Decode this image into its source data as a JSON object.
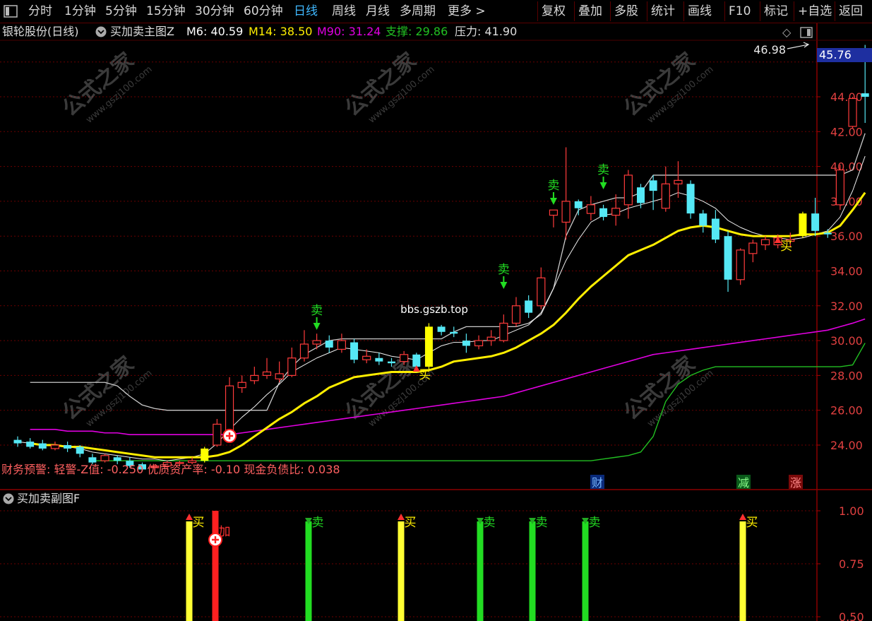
{
  "topbar": {
    "left_items": [
      "分时",
      "1分钟",
      "5分钟",
      "15分钟",
      "30分钟",
      "60分钟",
      "日线",
      "周线",
      "月线",
      "多周期",
      "更多 >"
    ],
    "active_item": "日线",
    "right_items": [
      "复权",
      "叠加",
      "多股",
      "统计",
      "画线",
      "F10",
      "标记",
      "+自选",
      "返回"
    ]
  },
  "main_header": {
    "stock": "银轮股份(日线)",
    "indicator": "买加卖主图Z",
    "m6": "M6: 40.59",
    "m14": "M14: 38.50",
    "m90": "M90: 31.24",
    "support": "支撑: 29.86",
    "pressure": "压力: 41.90"
  },
  "colors": {
    "bg": "#000000",
    "grid": "#6b0000",
    "up": "#ff3b3b",
    "down": "#55e8f5",
    "m6": "#ffffff",
    "m14": "#ffee00",
    "m90": "#e000e0",
    "support": "#22c022",
    "sell": "#22dd22",
    "buy_bar": "#ffff33",
    "add_bar": "#ff2020",
    "price_tag": "#1e2fa0"
  },
  "price_axis": {
    "ticks": [
      "44.00",
      "42.00",
      "40.00",
      "38.00",
      "36.00",
      "34.00",
      "32.00",
      "30.00",
      "28.00",
      "26.00",
      "24.00"
    ],
    "current": "45.76",
    "high_label": "46.98"
  },
  "signals": {
    "main": [
      {
        "text": "卖",
        "kind": "sell"
      },
      {
        "text": "卖",
        "kind": "sell"
      },
      {
        "text": "卖",
        "kind": "sell"
      },
      {
        "text": "卖",
        "kind": "sell"
      },
      {
        "text": "买",
        "kind": "buy"
      },
      {
        "text": "买",
        "kind": "buy"
      }
    ],
    "watermark_text": "bbs.gszb.top"
  },
  "finance_warning": "财务预警: 轻警-Z值: -0.250 优质资产率: -0.10 现金负债比: 0.038",
  "event_markers": [
    "财",
    "减",
    "涨"
  ],
  "sub_chart": {
    "title": "买加卖副图F",
    "ticks": [
      "1.00",
      "0.75",
      "0.50"
    ],
    "bars": [
      {
        "label": "买",
        "kind": "buy"
      },
      {
        "label": "加",
        "kind": "add"
      },
      {
        "label": "卖",
        "kind": "sell"
      },
      {
        "label": "买",
        "kind": "buy"
      },
      {
        "label": "卖",
        "kind": "sell"
      },
      {
        "label": "卖",
        "kind": "sell"
      },
      {
        "label": "卖",
        "kind": "sell"
      },
      {
        "label": "买",
        "kind": "buy"
      }
    ]
  },
  "watermarks": {
    "cn": "公式之家",
    "url": "www.gszj100.com"
  },
  "candles": [
    {
      "o": 24.3,
      "c": 24.1,
      "h": 24.5,
      "l": 23.9
    },
    {
      "o": 24.2,
      "c": 23.9,
      "h": 24.4,
      "l": 23.8
    },
    {
      "o": 24.1,
      "c": 23.8,
      "h": 24.3,
      "l": 23.7
    },
    {
      "o": 23.8,
      "c": 24.0,
      "h": 24.2,
      "l": 23.7
    },
    {
      "o": 24.0,
      "c": 23.8,
      "h": 24.2,
      "l": 23.6
    },
    {
      "o": 23.9,
      "c": 23.5,
      "h": 24.0,
      "l": 23.3
    },
    {
      "o": 23.3,
      "c": 23.0,
      "h": 23.5,
      "l": 22.9
    },
    {
      "o": 23.1,
      "c": 23.4,
      "h": 23.5,
      "l": 23.0
    },
    {
      "o": 23.3,
      "c": 23.1,
      "h": 23.4,
      "l": 22.9
    },
    {
      "o": 23.1,
      "c": 22.8,
      "h": 23.3,
      "l": 22.7
    },
    {
      "o": 22.9,
      "c": 22.6,
      "h": 23.0,
      "l": 22.5
    },
    {
      "o": 22.7,
      "c": 22.8,
      "h": 22.9,
      "l": 22.4
    },
    {
      "o": 22.8,
      "c": 23.0,
      "h": 23.1,
      "l": 22.6
    },
    {
      "o": 23.0,
      "c": 23.0,
      "h": 23.1,
      "l": 22.8
    },
    {
      "o": 23.0,
      "c": 23.1,
      "h": 23.3,
      "l": 22.9
    },
    {
      "o": 23.1,
      "c": 23.8,
      "h": 23.9,
      "l": 23.0
    },
    {
      "o": 24.0,
      "c": 25.2,
      "h": 25.5,
      "l": 23.9
    },
    {
      "o": 24.5,
      "c": 27.4,
      "h": 27.9,
      "l": 24.3
    },
    {
      "o": 27.3,
      "c": 27.6,
      "h": 28.0,
      "l": 27.0
    },
    {
      "o": 27.7,
      "c": 28.0,
      "h": 28.5,
      "l": 27.5
    },
    {
      "o": 28.0,
      "c": 28.2,
      "h": 29.0,
      "l": 27.8
    },
    {
      "o": 27.8,
      "c": 28.1,
      "h": 28.8,
      "l": 27.6
    },
    {
      "o": 28.0,
      "c": 29.0,
      "h": 29.6,
      "l": 27.9
    },
    {
      "o": 29.0,
      "c": 29.8,
      "h": 30.6,
      "l": 28.8
    },
    {
      "o": 29.8,
      "c": 30.0,
      "h": 30.4,
      "l": 29.5
    },
    {
      "o": 30.0,
      "c": 29.6,
      "h": 30.3,
      "l": 29.3
    },
    {
      "o": 29.5,
      "c": 30.0,
      "h": 30.4,
      "l": 29.3
    },
    {
      "o": 29.9,
      "c": 28.9,
      "h": 30.1,
      "l": 28.7
    },
    {
      "o": 28.9,
      "c": 29.1,
      "h": 29.5,
      "l": 28.7
    },
    {
      "o": 29.0,
      "c": 28.8,
      "h": 29.3,
      "l": 28.6
    },
    {
      "o": 28.8,
      "c": 28.7,
      "h": 29.0,
      "l": 28.5
    },
    {
      "o": 28.8,
      "c": 29.2,
      "h": 29.4,
      "l": 28.6
    },
    {
      "o": 29.2,
      "c": 28.5,
      "h": 29.3,
      "l": 28.2
    },
    {
      "o": 28.5,
      "c": 30.8,
      "h": 31.0,
      "l": 28.3
    },
    {
      "o": 30.8,
      "c": 30.5,
      "h": 30.9,
      "l": 30.3
    },
    {
      "o": 30.5,
      "c": 30.4,
      "h": 30.8,
      "l": 30.2
    },
    {
      "o": 30.0,
      "c": 29.7,
      "h": 30.4,
      "l": 29.3
    },
    {
      "o": 29.7,
      "c": 30.0,
      "h": 30.3,
      "l": 29.5
    },
    {
      "o": 30.0,
      "c": 30.2,
      "h": 30.6,
      "l": 29.7
    },
    {
      "o": 30.0,
      "c": 31.0,
      "h": 31.5,
      "l": 29.9
    },
    {
      "o": 31.0,
      "c": 32.0,
      "h": 32.5,
      "l": 30.8
    },
    {
      "o": 32.3,
      "c": 31.6,
      "h": 32.6,
      "l": 31.3
    },
    {
      "o": 32.0,
      "c": 33.6,
      "h": 34.2,
      "l": 31.8
    },
    {
      "o": 37.2,
      "c": 37.5,
      "h": 37.5,
      "l": 36.5
    },
    {
      "o": 36.8,
      "c": 38.0,
      "h": 41.1,
      "l": 35.8
    },
    {
      "o": 38.0,
      "c": 37.6,
      "h": 38.1,
      "l": 37.2
    },
    {
      "o": 37.3,
      "c": 37.8,
      "h": 38.3,
      "l": 36.9
    },
    {
      "o": 37.6,
      "c": 37.1,
      "h": 37.8,
      "l": 36.9
    },
    {
      "o": 37.2,
      "c": 37.6,
      "h": 38.4,
      "l": 36.6
    },
    {
      "o": 37.8,
      "c": 39.5,
      "h": 39.8,
      "l": 37.0
    },
    {
      "o": 38.8,
      "c": 37.9,
      "h": 39.0,
      "l": 37.6
    },
    {
      "o": 39.2,
      "c": 38.6,
      "h": 39.5,
      "l": 37.5
    },
    {
      "o": 37.6,
      "c": 39.0,
      "h": 40.0,
      "l": 37.4
    },
    {
      "o": 39.0,
      "c": 39.2,
      "h": 40.3,
      "l": 38.2
    },
    {
      "o": 39.0,
      "c": 37.3,
      "h": 39.2,
      "l": 37.0
    },
    {
      "o": 37.3,
      "c": 36.6,
      "h": 37.5,
      "l": 36.2
    },
    {
      "o": 37.0,
      "c": 35.8,
      "h": 37.5,
      "l": 35.6
    },
    {
      "o": 36.0,
      "c": 33.5,
      "h": 36.3,
      "l": 32.8
    },
    {
      "o": 33.5,
      "c": 35.2,
      "h": 35.3,
      "l": 33.2
    },
    {
      "o": 35.0,
      "c": 35.6,
      "h": 35.8,
      "l": 34.5
    },
    {
      "o": 35.5,
      "c": 35.8,
      "h": 36.0,
      "l": 35.2
    },
    {
      "o": 35.5,
      "c": 35.9,
      "h": 36.1,
      "l": 35.3
    },
    {
      "o": 35.7,
      "c": 35.8,
      "h": 36.2,
      "l": 35.4
    },
    {
      "o": 36.0,
      "c": 37.3,
      "h": 37.4,
      "l": 35.9
    },
    {
      "o": 37.3,
      "c": 36.3,
      "h": 38.2,
      "l": 36.0
    },
    {
      "o": 36.2,
      "c": 36.1,
      "h": 36.4,
      "l": 35.9
    },
    {
      "o": 37.8,
      "c": 39.8,
      "h": 40.1,
      "l": 37.5
    },
    {
      "o": 42.3,
      "c": 43.9,
      "h": 44.0,
      "l": 42.2
    },
    {
      "o": 44.2,
      "c": 44.0,
      "h": 46.98,
      "l": 42.5
    }
  ],
  "m6": [
    24.2,
    24.1,
    24.0,
    24.0,
    23.9,
    23.8,
    23.6,
    23.5,
    23.4,
    23.3,
    23.2,
    23.2,
    23.1,
    23.2,
    23.3,
    23.5,
    24.1,
    24.9,
    25.6,
    26.2,
    26.9,
    27.5,
    28.2,
    28.6,
    29.0,
    29.3,
    29.6,
    29.5,
    29.4,
    29.3,
    29.1,
    29.0,
    28.9,
    29.3,
    29.7,
    29.9,
    29.9,
    30.0,
    30.0,
    30.3,
    30.6,
    30.9,
    31.6,
    33.0,
    34.6,
    35.8,
    36.8,
    37.2,
    37.3,
    37.6,
    37.8,
    38.0,
    38.2,
    38.5,
    38.3,
    38.0,
    37.6,
    36.9,
    36.5,
    36.2,
    36.0,
    35.9,
    35.8,
    35.9,
    36.1,
    36.3,
    37.1,
    38.6,
    40.59
  ],
  "m14": [
    24.1,
    24.0,
    24.0,
    23.9,
    23.9,
    23.8,
    23.7,
    23.6,
    23.5,
    23.4,
    23.3,
    23.3,
    23.3,
    23.3,
    23.3,
    23.4,
    23.6,
    24.0,
    24.5,
    25.0,
    25.5,
    25.9,
    26.4,
    26.8,
    27.3,
    27.6,
    27.9,
    28.0,
    28.1,
    28.2,
    28.2,
    28.2,
    28.3,
    28.5,
    28.8,
    28.9,
    29.0,
    29.1,
    29.3,
    29.6,
    30.0,
    30.4,
    30.9,
    31.6,
    32.4,
    33.1,
    33.7,
    34.3,
    34.9,
    35.2,
    35.5,
    35.9,
    36.3,
    36.5,
    36.6,
    36.5,
    36.3,
    36.1,
    36.0,
    36.0,
    36.0,
    36.0,
    36.1,
    36.1,
    36.2,
    36.6,
    37.5,
    38.5
  ],
  "m90": [
    24.9,
    24.9,
    24.9,
    24.8,
    24.8,
    24.8,
    24.7,
    24.7,
    24.6,
    24.6,
    24.6,
    24.6,
    24.6,
    24.6,
    24.6,
    24.6,
    24.6,
    24.7,
    24.8,
    24.9,
    25.0,
    25.1,
    25.2,
    25.3,
    25.4,
    25.5,
    25.6,
    25.7,
    25.8,
    25.9,
    26.0,
    26.1,
    26.2,
    26.3,
    26.4,
    26.5,
    26.6,
    26.7,
    26.8,
    27.0,
    27.2,
    27.4,
    27.6,
    27.8,
    28.0,
    28.2,
    28.4,
    28.6,
    28.8,
    29.0,
    29.2,
    29.3,
    29.4,
    29.5,
    29.6,
    29.7,
    29.8,
    29.9,
    30.0,
    30.1,
    30.2,
    30.3,
    30.4,
    30.5,
    30.6,
    30.8,
    31.0,
    31.24
  ],
  "pressure": [
    27.6,
    27.6,
    27.6,
    27.6,
    27.6,
    27.6,
    27.6,
    27.4,
    26.8,
    26.3,
    26.1,
    26.0,
    26.0,
    26.0,
    26.0,
    26.0,
    26.0,
    26.0,
    26.0,
    26.0,
    27.6,
    28.5,
    29.2,
    29.6,
    30.0,
    30.1,
    30.1,
    30.1,
    30.1,
    30.1,
    30.1,
    30.1,
    30.1,
    30.1,
    30.5,
    30.8,
    30.8,
    30.8,
    30.8,
    30.8,
    31.0,
    31.5,
    33.0,
    36.0,
    37.5,
    37.8,
    38.0,
    38.2,
    38.2,
    38.5,
    39.5,
    39.5,
    39.5,
    39.5,
    39.5,
    39.5,
    39.5,
    39.5,
    39.5,
    39.5,
    39.5,
    39.5,
    39.5,
    39.5,
    39.5,
    39.5,
    39.8,
    41.9
  ],
  "support": [
    23.1,
    23.1,
    23.1,
    23.1,
    23.1,
    23.1,
    23.1,
    23.1,
    23.1,
    23.1,
    23.1,
    23.1,
    23.1,
    23.1,
    23.1,
    23.1,
    23.1,
    23.1,
    23.1,
    23.1,
    23.1,
    23.1,
    23.1,
    23.1,
    23.1,
    23.1,
    23.1,
    23.1,
    23.1,
    23.1,
    23.1,
    23.1,
    23.1,
    23.1,
    23.1,
    23.1,
    23.1,
    23.1,
    23.1,
    23.1,
    23.1,
    23.2,
    23.3,
    23.4,
    23.6,
    24.5,
    26.5,
    27.5,
    28.0,
    28.3,
    28.5,
    28.5,
    28.5,
    28.5,
    28.5,
    28.5,
    28.5,
    28.5,
    28.5,
    28.5,
    28.5,
    28.6,
    29.86
  ]
}
